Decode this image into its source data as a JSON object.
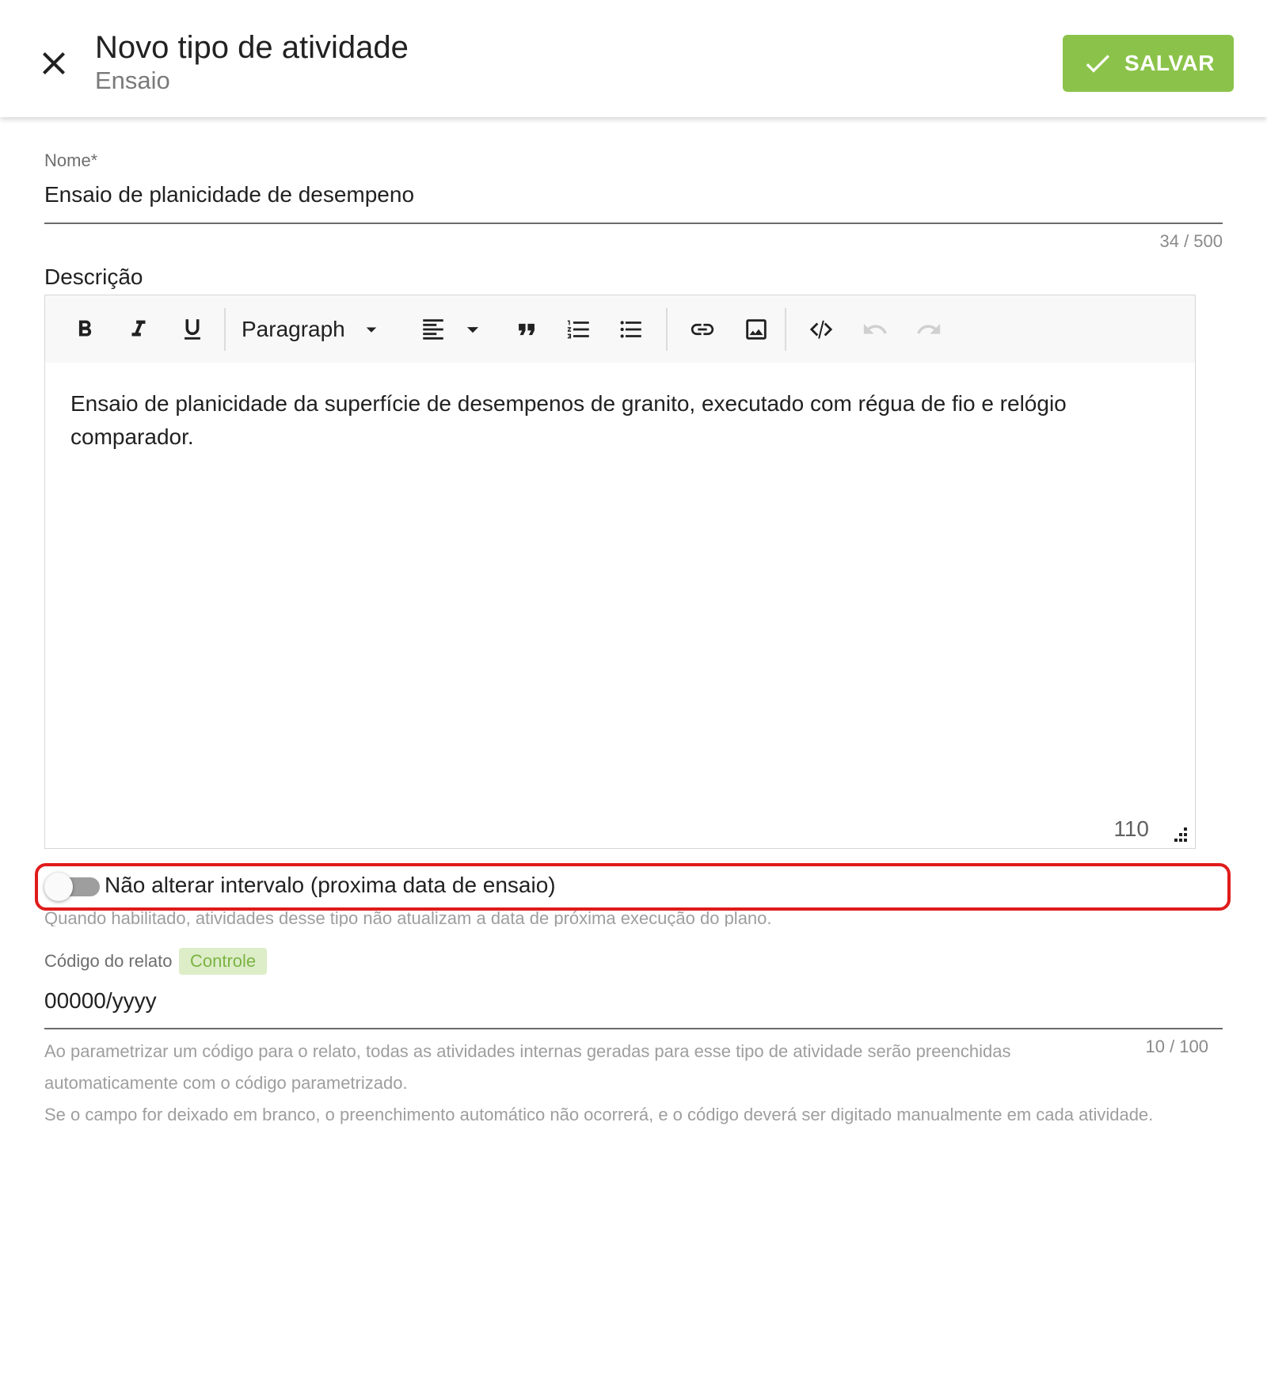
{
  "header": {
    "title": "Novo tipo de atividade",
    "subtitle": "Ensaio",
    "close_icon": "close-icon",
    "save_label": "SALVAR",
    "save_icon": "check-icon",
    "save_color": "#8bc34a"
  },
  "nome": {
    "label": "Nome*",
    "value": "Ensaio de planicidade de desempeno",
    "counter": "34 / 500"
  },
  "descricao": {
    "label": "Descrição",
    "toolbar": {
      "paragraph_select": "Paragraph",
      "buttons": [
        "bold-icon",
        "italic-icon",
        "underline-icon",
        "align-left-icon",
        "quote-icon",
        "ordered-list-icon",
        "bullet-list-icon",
        "link-icon",
        "image-icon",
        "code-icon",
        "undo-icon",
        "redo-icon"
      ]
    },
    "content": "Ensaio de planicidade da superfície de desempenos de granito, executado com régua de fio e relógio comparador.",
    "char_count": "110"
  },
  "toggle": {
    "label": "Não alterar intervalo (proxima data de ensaio)",
    "hint": "Quando habilitado, atividades desse tipo não atualizam a data de próxima execução do plano.",
    "checked": false,
    "highlight_color": "#e01b1b"
  },
  "codigo": {
    "label": "Código do relato",
    "chip": "Controle",
    "value": "00000/yyyy",
    "counter": "10 / 100",
    "hint": "Ao parametrizar um código para o relato, todas as atividades internas geradas para esse tipo de atividade serão preenchidas automaticamente com o código parametrizado.",
    "hint2": "Se o campo for deixado em branco, o preenchimento automático não ocorrerá, e o código deverá ser digitado manualmente em cada atividade."
  }
}
